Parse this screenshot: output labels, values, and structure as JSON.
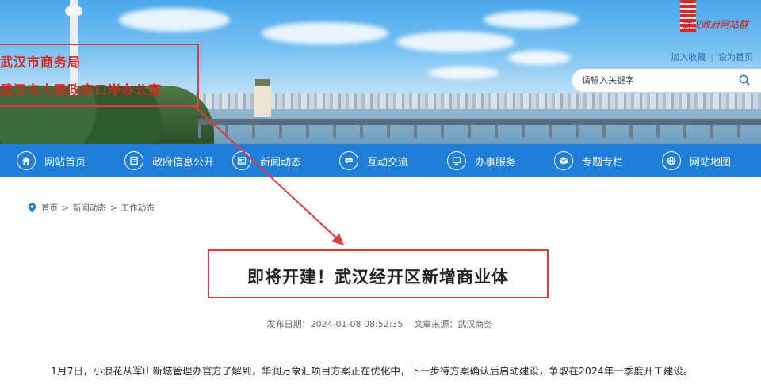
{
  "header": {
    "org_lines": [
      "武汉市商务局",
      "武汉市人民政府口岸办公室"
    ],
    "logo_text": "武汉政府网站群",
    "links": [
      "加入收藏",
      "设为首页"
    ],
    "link_separator": "|",
    "search": {
      "placeholder": "请输入关键字",
      "value": ""
    }
  },
  "nav": {
    "items": [
      {
        "label": "网站首页",
        "icon": "home-icon"
      },
      {
        "label": "政府信息公开",
        "icon": "document-icon"
      },
      {
        "label": "新闻动态",
        "icon": "news-icon"
      },
      {
        "label": "互动交流",
        "icon": "chat-icon"
      },
      {
        "label": "办事服务",
        "icon": "monitor-icon"
      },
      {
        "label": "专题专栏",
        "icon": "cube-icon"
      },
      {
        "label": "网站地图",
        "icon": "globe-icon"
      }
    ]
  },
  "breadcrumb": [
    "首页",
    "新闻动态",
    "工作动态"
  ],
  "breadcrumb_separator": ">",
  "article": {
    "title": "即将开建！武汉经开区新增商业体",
    "date_label": "发布日期：",
    "date": "2024-01-08 08:52:35",
    "source_label": "文章来源：",
    "source": "武汉商务",
    "body": "1月7日，小浪花从军山新城管理办官方了解到，华润万象汇项目方案正在优化中，下一步待方案确认后启动建设，争取在2024年一季度开工建设。"
  },
  "colors": {
    "nav_bg": "#1e7ed8",
    "highlight": "#e23b3b",
    "org_text": "#d7261e"
  }
}
